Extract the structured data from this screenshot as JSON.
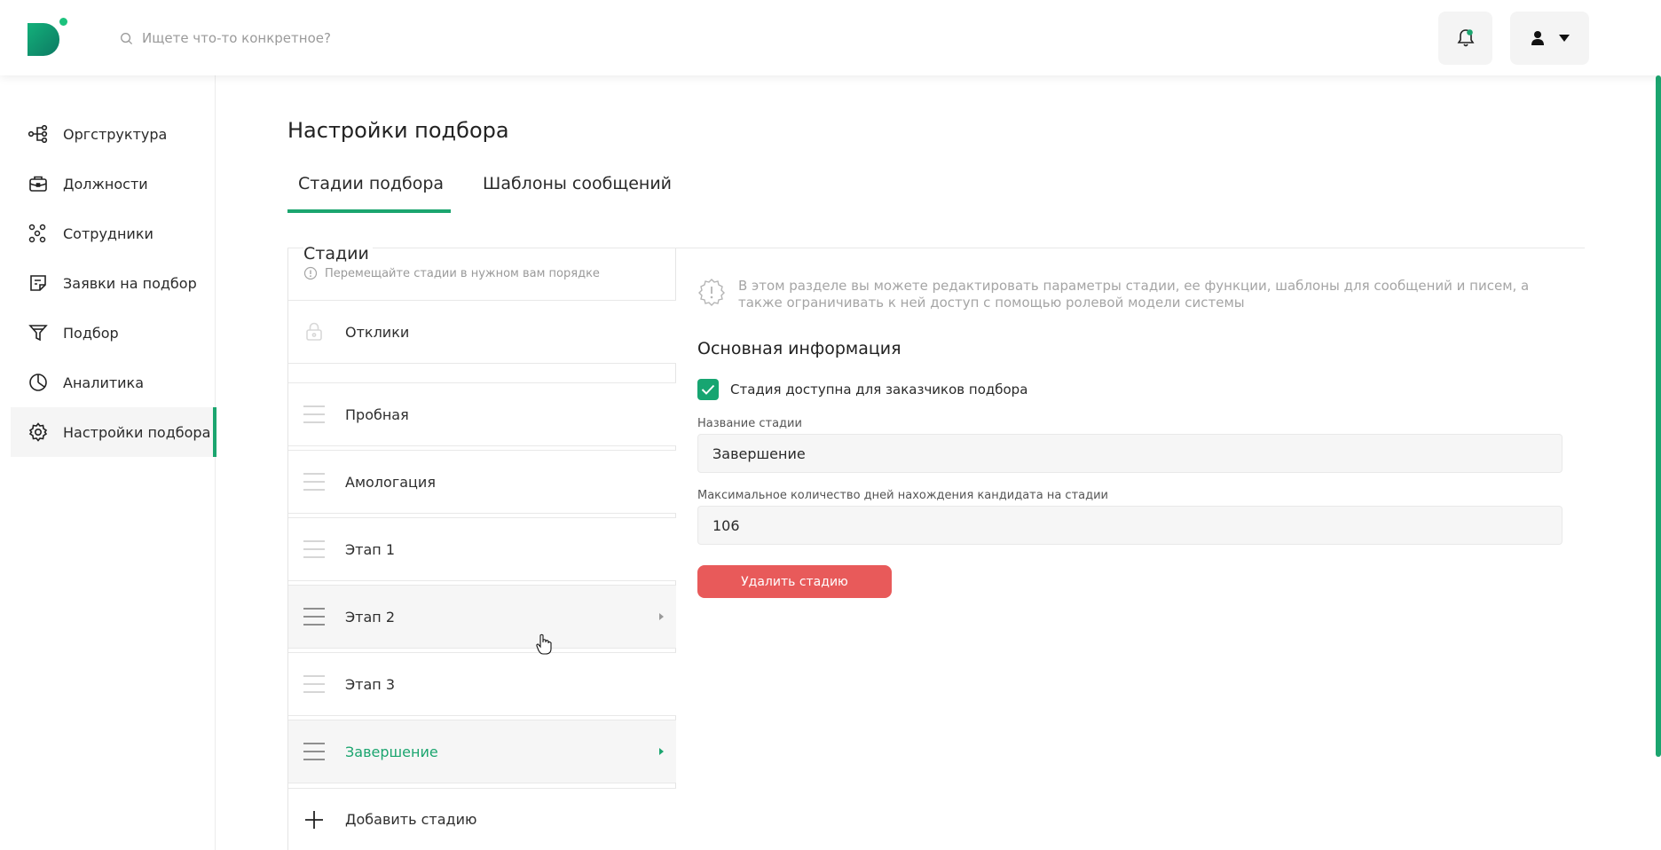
{
  "header": {
    "search_placeholder": "Ищете что-то конкретное?"
  },
  "sidebar": {
    "items": [
      {
        "label": "Оргструктура",
        "icon": "org-structure-icon"
      },
      {
        "label": "Должности",
        "icon": "briefcase-icon"
      },
      {
        "label": "Сотрудники",
        "icon": "people-icon"
      },
      {
        "label": "Заявки на подбор",
        "icon": "request-doc-icon"
      },
      {
        "label": "Подбор",
        "icon": "funnel-icon"
      },
      {
        "label": "Аналитика",
        "icon": "pie-chart-icon"
      },
      {
        "label": "Настройки подбора",
        "icon": "gear-icon"
      }
    ]
  },
  "main": {
    "title": "Настройки подбора",
    "tabs": [
      {
        "label": "Стадии подбора"
      },
      {
        "label": "Шаблоны сообщений"
      }
    ]
  },
  "stages": {
    "title": "Стадии",
    "hint": "Перемещайте стадии в нужном вам порядке",
    "items": [
      {
        "label": "Отклики"
      },
      {
        "label": "Пробная"
      },
      {
        "label": "Амологация"
      },
      {
        "label": "Этап 1"
      },
      {
        "label": "Этап 2"
      },
      {
        "label": "Этап 3"
      },
      {
        "label": "Завершение"
      }
    ],
    "add_label": "Добавить стадию"
  },
  "details": {
    "info": "В этом разделе вы можете редактировать параметры стадии, ее функции, шаблоны для сообщений и писем, а также ограничивать к ней доступ с помощью ролевой модели системы",
    "section_title": "Основная информация",
    "checkbox_label": "Стадия доступна для заказчиков подбора",
    "name_label": "Название стадии",
    "name_value": "Завершение",
    "days_label": "Максимальное количество дней нахождения кандидата на стадии",
    "days_value": "106",
    "delete_label": "Удалить стадию"
  },
  "colors": {
    "accent": "#1ba56f",
    "danger": "#e85a5a"
  }
}
